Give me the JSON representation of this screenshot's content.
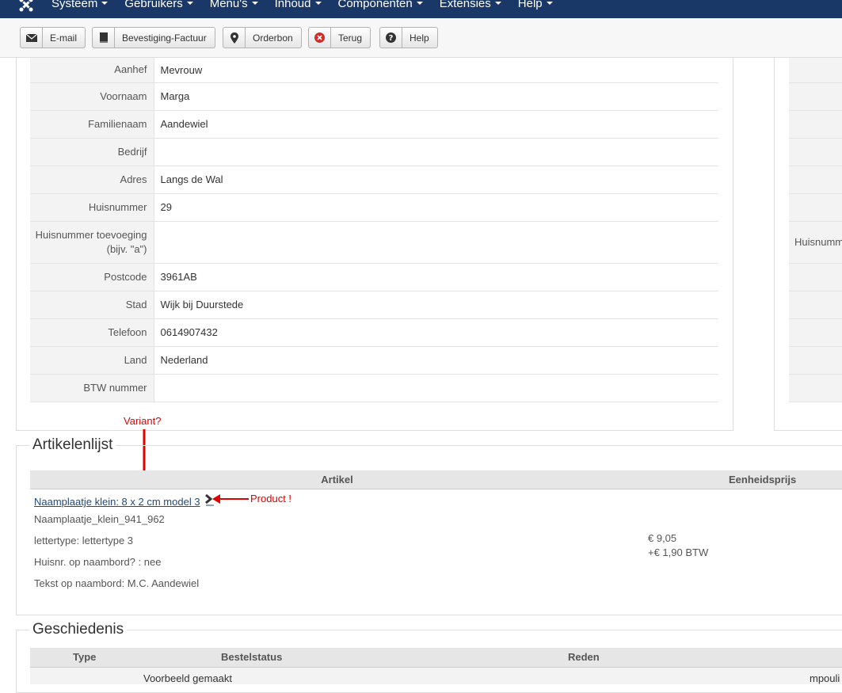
{
  "navbar": {
    "items": [
      "Systeem",
      "Gebruikers",
      "Menu's",
      "Inhoud",
      "Componenten",
      "Extensies",
      "Help"
    ]
  },
  "toolbar": {
    "buttons": [
      {
        "label": "E-mail",
        "icon": "envelope-icon"
      },
      {
        "label": "Bevestiging-Factuur",
        "icon": "book-icon"
      },
      {
        "label": "Orderbon",
        "icon": "location-pin-icon"
      },
      {
        "label": "Terug",
        "icon": "cancel-circle-icon"
      },
      {
        "label": "Help",
        "icon": "question-circle-icon"
      }
    ]
  },
  "address": {
    "rows": [
      {
        "label": "Aanhef",
        "value": "Mevrouw"
      },
      {
        "label": "Voornaam",
        "value": "Marga"
      },
      {
        "label": "Familienaam",
        "value": "Aandewiel"
      },
      {
        "label": "Bedrijf",
        "value": ""
      },
      {
        "label": "Adres",
        "value": "Langs de Wal"
      },
      {
        "label": "Huisnummer",
        "value": "29"
      },
      {
        "label": "Huisnummer toevoeging (bijv. \"a\")",
        "value": ""
      },
      {
        "label": "Postcode",
        "value": "3961AB"
      },
      {
        "label": "Stad",
        "value": "Wijk bij Duurstede"
      },
      {
        "label": "Telefoon",
        "value": "0614907432"
      },
      {
        "label": "Land",
        "value": "Nederland"
      },
      {
        "label": "BTW nummer",
        "value": ""
      }
    ],
    "right_partial_label": "Huisnumm"
  },
  "articles": {
    "legend": "Artikelenlijst",
    "col_article": "Artikel",
    "col_unit_price": "Eenheidsprijs",
    "item_link": "Naamplaatje klein: 8 x 2 cm model 3",
    "item_sku": "Naamplaatje_klein_941_962",
    "attributes": [
      "lettertype: lettertype 3",
      "Huisnr. op naambord? : nee",
      "Tekst op naambord: M.C. Aandewiel"
    ],
    "price": "€ 9,05",
    "tax": "+€ 1,90 BTW"
  },
  "annotations": {
    "variant": "Variant?",
    "product": "Product !"
  },
  "history": {
    "legend": "Geschiedenis",
    "col_type": "Type",
    "col_status": "Bestelstatus",
    "col_reason": "Reden",
    "row_status": "Voorbeeld gemaakt",
    "row_user": "mpouli"
  },
  "colors": {
    "navbar": "#1a3867",
    "annotation": "#e00000",
    "link": "#1f4a7a"
  }
}
